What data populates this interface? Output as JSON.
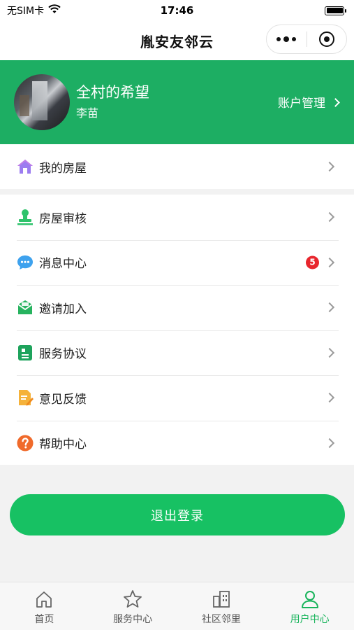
{
  "status_bar": {
    "carrier": "无SIM卡",
    "time": "17:46"
  },
  "nav": {
    "title": "胤安友邻云"
  },
  "profile": {
    "name": "全村的希望",
    "sub_name": "李苗",
    "account_label": "账户管理"
  },
  "menu_top": [
    {
      "label": "我的房屋",
      "icon": "house-icon"
    }
  ],
  "menu_main": [
    {
      "label": "房屋审核",
      "icon": "stamp-icon"
    },
    {
      "label": "消息中心",
      "icon": "chat-bubble-icon",
      "badge": "5"
    },
    {
      "label": "邀请加入",
      "icon": "mail-icon"
    },
    {
      "label": "服务协议",
      "icon": "document-icon"
    },
    {
      "label": "意见反馈",
      "icon": "feedback-icon"
    },
    {
      "label": "帮助中心",
      "icon": "help-icon"
    }
  ],
  "logout_label": "退出登录",
  "tabs": [
    {
      "label": "首页",
      "icon": "home-icon",
      "active": false
    },
    {
      "label": "服务中心",
      "icon": "star-icon",
      "active": false
    },
    {
      "label": "社区邻里",
      "icon": "building-icon",
      "active": false
    },
    {
      "label": "用户中心",
      "icon": "user-icon",
      "active": true
    }
  ],
  "colors": {
    "brand_green": "#1dae63",
    "button_green": "#17c163",
    "active_tab": "#19b45c",
    "badge_red": "#e8262d"
  }
}
